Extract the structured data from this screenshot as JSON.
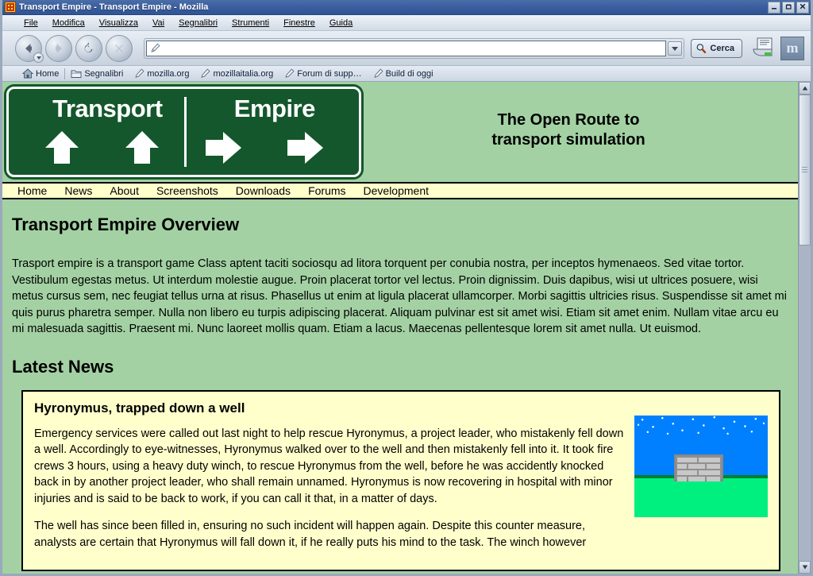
{
  "window": {
    "title": "Transport Empire - Transport Empire - Mozilla",
    "app_icon": "transport-empire-favicon",
    "minimize_label": "_",
    "restore_label": "❐",
    "close_label": "✕"
  },
  "menubar": {
    "items": [
      {
        "label": "File",
        "accel": "F"
      },
      {
        "label": "Modifica",
        "accel": "M"
      },
      {
        "label": "Visualizza",
        "accel": "V"
      },
      {
        "label": "Vai",
        "accel": "a"
      },
      {
        "label": "Segnalibri",
        "accel": "S"
      },
      {
        "label": "Strumenti",
        "accel": "S"
      },
      {
        "label": "Finestre",
        "accel": "e"
      },
      {
        "label": "Guida",
        "accel": "G"
      }
    ]
  },
  "toolbar": {
    "back_icon": "back-arrow-icon",
    "forward_icon": "forward-arrow-icon",
    "reload_icon": "reload-icon",
    "stop_icon": "stop-icon",
    "url_icon": "pencil-edit-icon",
    "url_value": "",
    "url_placeholder": "",
    "url_dropdown_icon": "chevron-down-icon",
    "search_label": "Cerca",
    "search_icon": "magnifier-icon",
    "print_icon": "print-icon",
    "print_dropdown_icon": "chevron-down-icon",
    "throbber_label": "m"
  },
  "bookmarks_toolbar": {
    "items": [
      {
        "label": "Home",
        "icon": "home-icon"
      },
      {
        "label": "Segnalibri",
        "icon": "folder-icon"
      },
      {
        "label": "mozilla.org",
        "icon": "bookmark-icon"
      },
      {
        "label": "mozillaitalia.org",
        "icon": "bookmark-icon"
      },
      {
        "label": "Forum di supp…",
        "icon": "bookmark-icon"
      },
      {
        "label": "Build di oggi",
        "icon": "bookmark-icon"
      }
    ]
  },
  "site": {
    "logo": {
      "word_left": "Transport",
      "word_right": "Empire",
      "arrows": [
        "up",
        "up",
        "right",
        "right"
      ],
      "sign_color": "#14572c",
      "border_color": "#ffffff"
    },
    "tagline_line1": "The Open Route to",
    "tagline_line2": "transport simulation",
    "nav": [
      {
        "label": "Home"
      },
      {
        "label": "News"
      },
      {
        "label": "About"
      },
      {
        "label": "Screenshots"
      },
      {
        "label": "Downloads"
      },
      {
        "label": "Forums"
      },
      {
        "label": "Development"
      }
    ],
    "colors": {
      "page_background": "#a3d1a3",
      "nav_background": "#ffffcc",
      "box_background": "#ffffcc",
      "sign_green": "#14572c"
    }
  },
  "content": {
    "overview_heading": "Transport Empire Overview",
    "overview_paragraph_1": "Trasport empire is a transport game Class aptent taciti sociosqu ad litora torquent per conubia nostra, per inceptos hymenaeos. Sed vitae tortor. Vestibulum egestas metus. Ut interdum molestie augue. Proin placerat tortor vel lectus. Proin dignissim. Duis dapibus, wisi ut ultrices posuere, wisi metus cursus sem, nec feugiat tellus urna at risus. Phasellus ut enim at ligula placerat ullamcorper. Morbi sagittis ultricies risus. Suspendisse sit amet mi quis purus pharetra semper. Nulla non libero eu turpis adipiscing placerat. Aliquam pulvinar est sit amet wisi. Etiam sit amet enim. Nullam vitae arcu eu mi malesuada sagittis. Praesent mi. Nunc laoreet mollis quam. Etiam a lacus. Maecenas pellentesque lorem sit amet nulla. Ut euismod.",
    "news_heading": "Latest News",
    "news_item": {
      "title": "Hyronymus, trapped down a well",
      "paragraph_1": "Emergency services were called out last night to help rescue Hyronymus, a project leader, who mistakenly fell down a well. Accordingly to eye-witnesses, Hyronymus walked over to the well and then mistakenly fell into it. It took fire crews 3 hours, using a heavy duty winch, to rescue Hyronymus from the well, before he was accidently knocked back in by another project leader, who shall remain unnamed. Hyronymus is now recovering in hospital with minor injuries and is said to be back to work, if you can call it that, in a matter of days.",
      "paragraph_2": "The well has since been filled in, ensuring no such incident will happen again. Despite this counter measure, analysts are certain that Hyronymus will fall down it, if he really puts his mind to the task. The winch however",
      "image_alt": "well-illustration"
    }
  },
  "scrollbar": {
    "up_icon": "scroll-up-arrow",
    "down_icon": "scroll-down-arrow"
  }
}
